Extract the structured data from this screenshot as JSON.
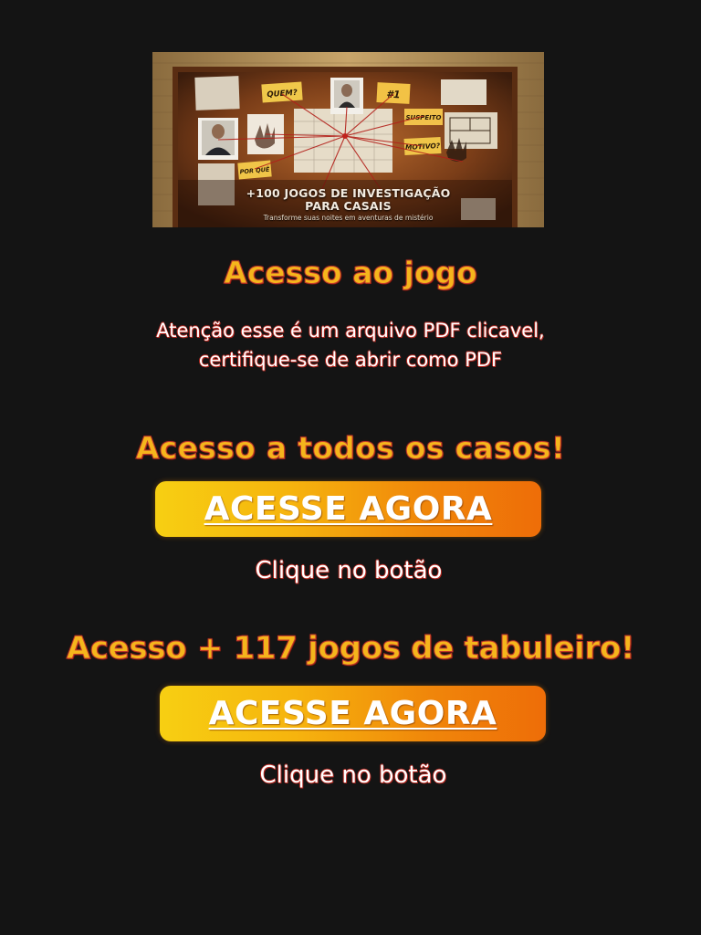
{
  "banner": {
    "title_line1": "+100 JOGOS DE INVESTIGAÇÃO",
    "title_line2": "PARA CASAIS",
    "subtitle": "Transforme suas noites em aventuras de mistério",
    "notes": {
      "who": "QUEM?",
      "number": "#1",
      "suspect": "SUSPEITO",
      "motive": "MOTIVO?",
      "why": "POR QUÊ"
    }
  },
  "section_game": {
    "heading": "Acesso ao jogo",
    "notice_line1": "Atenção esse é um arquivo PDF clicavel,",
    "notice_line2": "certifique-se de abrir como PDF"
  },
  "section_cases": {
    "heading": "Acesso a todos os casos!",
    "button_label": "ACESSE AGORA",
    "hint": "Clique no botão"
  },
  "section_boardgames": {
    "heading": "Acesso + 117 jogos de tabuleiro!",
    "button_label": "ACESSE AGORA",
    "hint": "Clique no botão"
  },
  "colors": {
    "background": "#141414",
    "heading": "#f5b51c",
    "heading_outline": "#c0392b",
    "button_gradient_start": "#f7cf12",
    "button_gradient_end": "#ee6d08"
  }
}
